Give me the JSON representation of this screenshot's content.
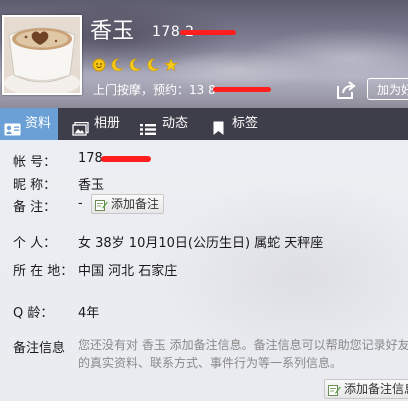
{
  "header": {
    "nickname": "香玉",
    "qq_visible": "178      2",
    "signature": "上门按摩，预约：13       8",
    "add_friend_label": "加为好友"
  },
  "tabs": [
    {
      "label": "资料",
      "icon": "profile-card-icon",
      "active": true
    },
    {
      "label": "相册",
      "icon": "photo-album-icon",
      "active": false
    },
    {
      "label": "动态",
      "icon": "feed-list-icon",
      "active": false
    },
    {
      "label": "标签",
      "icon": "bookmark-icon",
      "active": false
    }
  ],
  "profile": {
    "account_label": "帐    号：",
    "account_value": "178",
    "nickname_label": "昵    称：",
    "nickname_value": "香玉",
    "remark_label": "备    注：",
    "remark_value": "-",
    "add_remark_label": "添加备注",
    "personal_label": "个    人：",
    "personal_value": "女   38岁   10月10日(公历生日)   属蛇   天秤座",
    "location_label": "所 在 地：",
    "location_value": "中国  河北  石家庄",
    "qage_label": "Q      龄：",
    "qage_value": "4年",
    "note_info_label": "备注信息",
    "note_info_line1": "您还没有对 香玉 添加备注信息。备注信息可以帮助您记录好友",
    "note_info_line2": "的真实资料、联系方式、事件行为等一系列信息。",
    "add_note_info_label": "添加备注信息"
  },
  "colors": {
    "tab_bar": "#3e3d4a",
    "tab_active": "#6aa0d6",
    "redaction": "#ff1e1e",
    "content_bg": "#eceef3"
  }
}
